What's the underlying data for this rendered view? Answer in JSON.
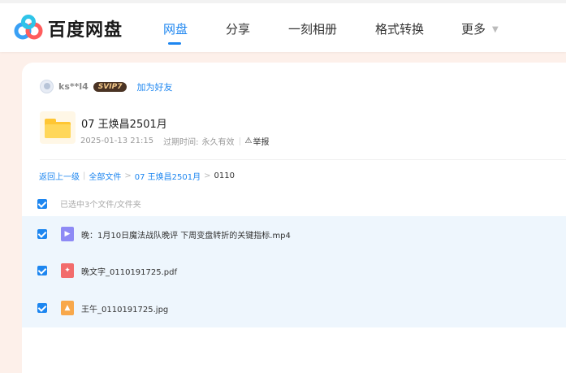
{
  "brand": {
    "logo_text": "百度网盘"
  },
  "nav": {
    "items": [
      {
        "label": "网盘",
        "active": true
      },
      {
        "label": "分享",
        "active": false
      },
      {
        "label": "一刻相册",
        "active": false
      },
      {
        "label": "格式转换",
        "active": false
      },
      {
        "label": "更多",
        "active": false
      }
    ],
    "accent_color": "#1d86f0"
  },
  "share": {
    "username": "ks**l4",
    "vip_badge": "SVIP7",
    "add_friend_label": "加为好友",
    "folder_title": "07 王焕昌2501月",
    "date": "2025-01-13 21:15",
    "expire_label": "过期时间:",
    "expire_value": "永久有效",
    "report_label": "举报"
  },
  "breadcrumb": {
    "back_label": "返回上一级",
    "all_files_label": "全部文件",
    "folder_label": "07 王焕昌2501月",
    "current_label": "0110",
    "separator": ">"
  },
  "selection": {
    "summary": "已选中3个文件/文件夹"
  },
  "files": [
    {
      "name": "晚：1月10日魔法战队晚评 下周变盘转折的关键指标.mp4",
      "type": "video",
      "icon": "video-file-icon",
      "checked": true
    },
    {
      "name": "晚文字_0110191725.pdf",
      "type": "pdf",
      "icon": "pdf-file-icon",
      "checked": true
    },
    {
      "name": "王午_0110191725.jpg",
      "type": "image",
      "icon": "image-file-icon",
      "checked": true
    }
  ]
}
